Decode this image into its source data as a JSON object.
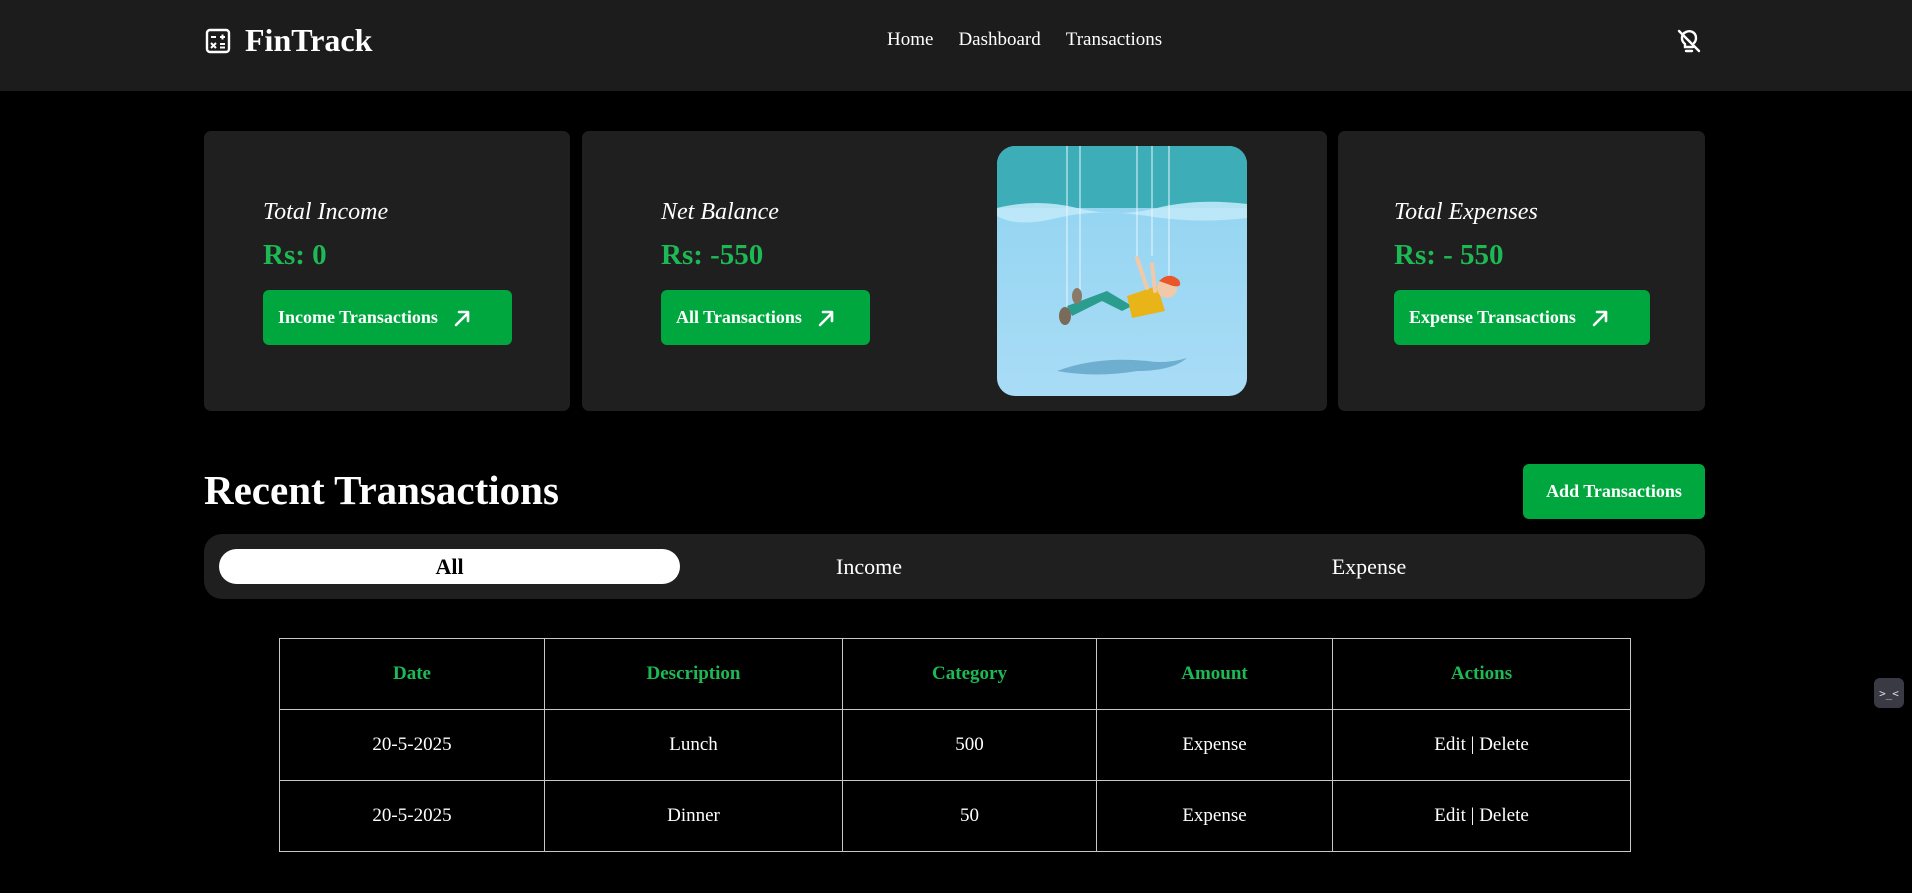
{
  "brand": {
    "name": "FinTrack",
    "icon": "calculator-icon"
  },
  "nav": {
    "links": [
      "Home",
      "Dashboard",
      "Transactions"
    ],
    "theme_icon": "lightbulb-off-icon"
  },
  "summary": {
    "income": {
      "title": "Total Income",
      "value": "Rs: 0",
      "button": "Income Transactions"
    },
    "balance": {
      "title": "Net Balance",
      "value": "Rs: -550",
      "button": "All Transactions",
      "illustration": "person-falling-underwater"
    },
    "expense": {
      "title": "Total Expenses",
      "value": "Rs: - 550",
      "button": "Expense Transactions"
    }
  },
  "recent": {
    "title": "Recent Transactions",
    "add_button": "Add Transactions"
  },
  "tabs": {
    "items": [
      "All",
      "Income",
      "Expense"
    ],
    "active": "All"
  },
  "table": {
    "headers": [
      "Date",
      "Description",
      "Category",
      "Amount",
      "Actions"
    ],
    "rows": [
      {
        "date": "20-5-2025",
        "description": "Lunch",
        "category": "500",
        "amount": "Expense",
        "edit": "Edit",
        "sep": "|",
        "delete": "Delete"
      },
      {
        "date": "20-5-2025",
        "description": "Dinner",
        "category": "50",
        "amount": "Expense",
        "edit": "Edit",
        "sep": "|",
        "delete": "Delete"
      }
    ]
  },
  "widget": {
    "label": ">_<"
  },
  "colors": {
    "accent": "#00a63e",
    "value_green": "#1db954",
    "navbar": "#1c1c1c",
    "card": "#1f1f1f",
    "page_bg": "#000000"
  }
}
